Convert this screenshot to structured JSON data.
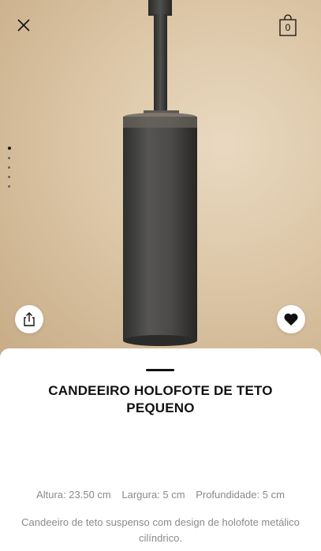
{
  "header": {
    "close_icon": "close-icon",
    "bag_icon": "shopping-bag-icon",
    "bag_count": "0"
  },
  "gallery": {
    "image_count": 5,
    "active_index": 0
  },
  "actions": {
    "share_icon": "share-icon",
    "favorite_icon": "heart-icon"
  },
  "product": {
    "title": "CANDEEIRO HOLOFOTE DE TETO PEQUENO",
    "dimensions": {
      "height": "Altura: 23.50 cm",
      "width": "Largura: 5 cm",
      "depth": "Profundidade: 5 cm"
    },
    "description": "Candeeiro de teto suspenso com design de holofote metálico cilíndrico."
  },
  "colors": {
    "background_beige": "#dcc6a6",
    "lamp_metal": "#4a4a48",
    "text_dark": "#111111",
    "text_muted": "#8a8a8a"
  }
}
